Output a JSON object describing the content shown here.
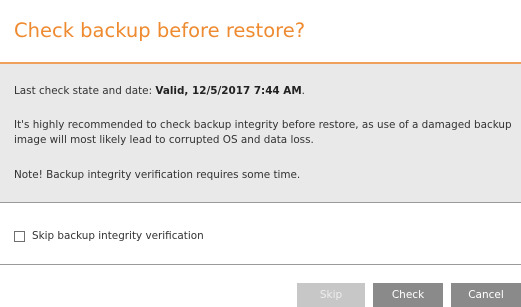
{
  "dialog": {
    "title": "Check backup before restore?",
    "last_check_prefix": "Last check state and date: ",
    "last_check_value": "Valid, 12/5/2017 7:44 AM",
    "last_check_suffix": ".",
    "recommendation": "It's highly recommended to check backup integrity before restore, as use of a damaged backup image will most likely lead to corrupted OS and data loss.",
    "note": "Note! Backup integrity verification requires some time.",
    "skip_option": {
      "label": "Skip backup integrity verification",
      "checked": false
    },
    "buttons": {
      "skip": "Skip",
      "check": "Check",
      "cancel": "Cancel"
    },
    "colors": {
      "accent": "#ee8a30",
      "panel": "#e9e9e9",
      "button": "#8a8a8a",
      "button_disabled": "#c7c7c7"
    }
  }
}
